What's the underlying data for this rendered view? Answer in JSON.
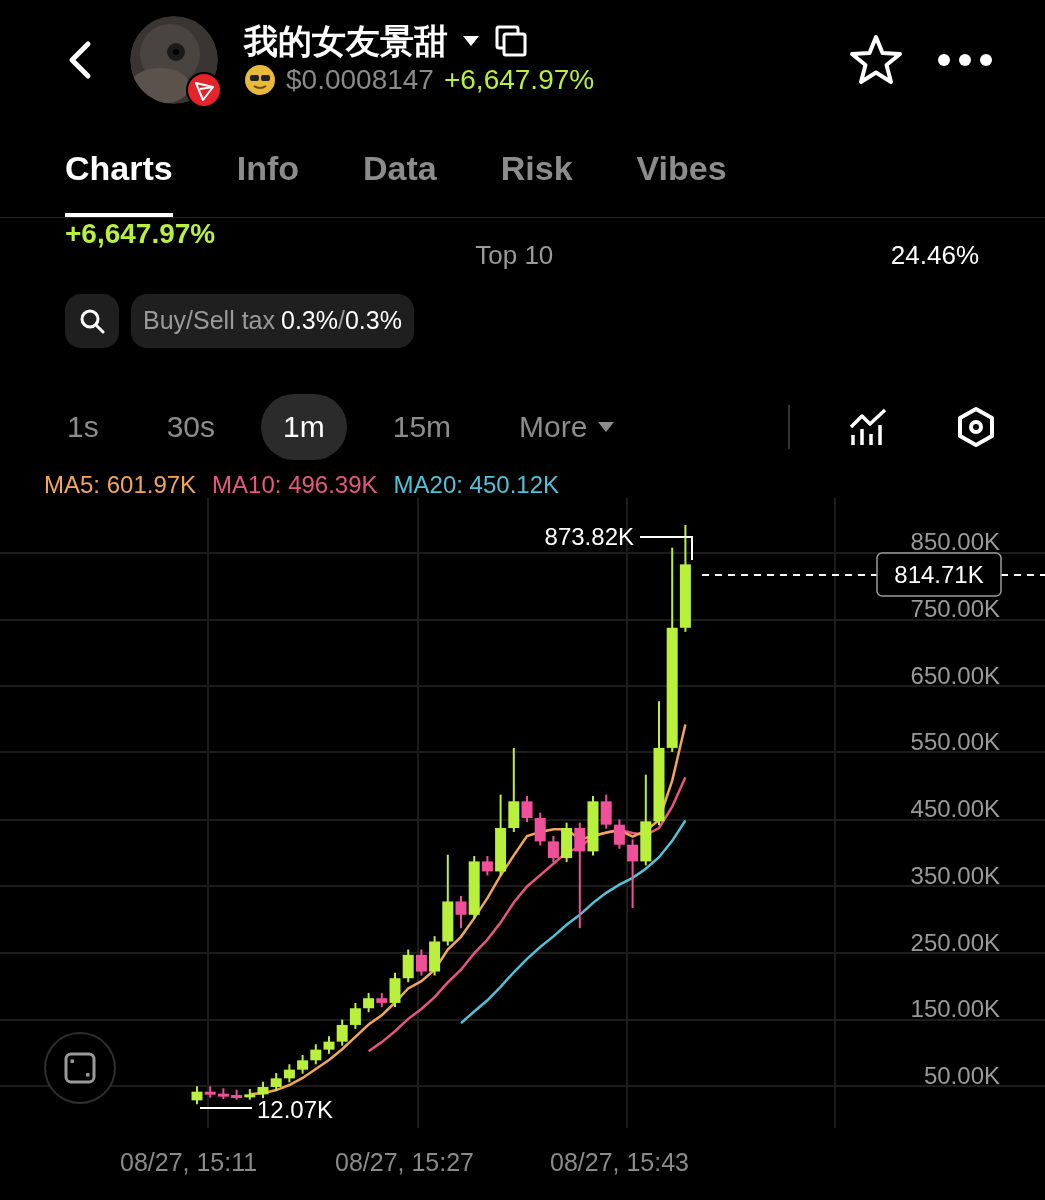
{
  "header": {
    "title": "我的女友景甜",
    "price": "$0.0008147",
    "change": "+6,647.97%"
  },
  "tabs": [
    {
      "label": "Charts",
      "selected": true
    },
    {
      "label": "Info",
      "selected": false
    },
    {
      "label": "Data",
      "selected": false
    },
    {
      "label": "Risk",
      "selected": false
    },
    {
      "label": "Vibes",
      "selected": false
    }
  ],
  "summary": {
    "change": "+6,647.97%",
    "stat_label": "Top 10",
    "stat_value": "24.46%"
  },
  "tax": {
    "label": "Buy/Sell tax",
    "buy": "0.3%",
    "separator": "/",
    "sell": "0.3%"
  },
  "intervals": [
    {
      "label": "1s",
      "selected": false
    },
    {
      "label": "30s",
      "selected": false
    },
    {
      "label": "1m",
      "selected": true
    },
    {
      "label": "15m",
      "selected": false
    }
  ],
  "more": "More",
  "indicators": [
    {
      "label": "MA5: 601.97K",
      "color": "#f2a65a"
    },
    {
      "label": "MA10: 496.39K",
      "color": "#e8567f"
    },
    {
      "label": "MA20: 450.12K",
      "color": "#4fc3d9"
    }
  ],
  "chart": {
    "yticks": [
      "850.00K",
      "750.00K",
      "650.00K",
      "550.00K",
      "450.00K",
      "350.00K",
      "250.00K",
      "150.00K",
      "50.00K"
    ],
    "xticks": [
      "08/27, 15:11",
      "08/27, 15:27",
      "08/27, 15:43"
    ],
    "high_label": "873.82K",
    "low_label": "12.07K",
    "current_price": "814.71K"
  }
}
